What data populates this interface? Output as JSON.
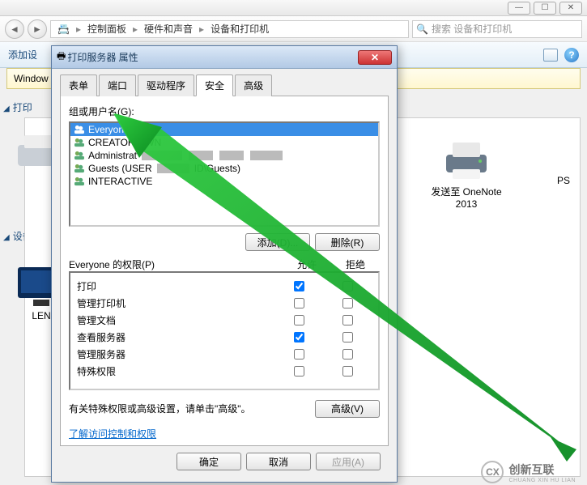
{
  "parent": {
    "breadcrumbs": [
      "控制面板",
      "硬件和声音",
      "设备和打印机"
    ],
    "search_placeholder": "搜索 设备和打印机",
    "action_add": "添加设",
    "info_prefix": "Window",
    "left": {
      "printers": "打印",
      "devices": "设备"
    },
    "device": {
      "onenote": "发送至 OneNote 2013",
      "ps_suffix": "PS",
      "len": "LEN"
    }
  },
  "dialog": {
    "title": "打印服务器 属性",
    "tabs": [
      "表单",
      "端口",
      "驱动程序",
      "安全",
      "高级"
    ],
    "groups_label": "组或用户名(G):",
    "users": [
      {
        "name": "Everyone",
        "selected": true
      },
      {
        "name": "CREATOR OWN"
      },
      {
        "name": "Administrat"
      },
      {
        "name": "Guests (USER",
        "mid": "ID\\Guests)"
      },
      {
        "name": "INTERACTIVE"
      }
    ],
    "add_btn": "添加(D)...",
    "remove_btn": "删除(R)",
    "perm_label": "Everyone 的权限(P)",
    "allow": "允许",
    "deny": "拒绝",
    "perms": [
      {
        "name": "打印",
        "allow": true,
        "deny": false
      },
      {
        "name": "管理打印机",
        "allow": false,
        "deny": false
      },
      {
        "name": "管理文档",
        "allow": false,
        "deny": false
      },
      {
        "name": "查看服务器",
        "allow": true,
        "deny": false
      },
      {
        "name": "管理服务器",
        "allow": false,
        "deny": false
      },
      {
        "name": "特殊权限",
        "allow": false,
        "deny": false
      }
    ],
    "adv_text": "有关特殊权限或高级设置，请单击\"高级\"。",
    "adv_btn": "高级(V)",
    "learn_link": "了解访问控制和权限",
    "ok": "确定",
    "cancel": "取消",
    "apply": "应用(A)"
  },
  "watermark": {
    "brand": "创新互联",
    "sub": "CHUANG XIN HU LIAN"
  }
}
